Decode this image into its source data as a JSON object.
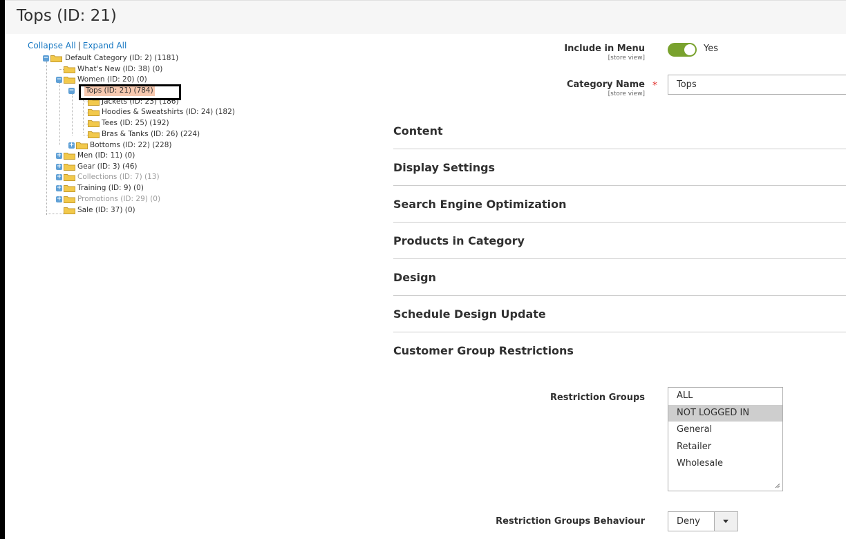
{
  "page": {
    "title": "Tops (ID: 21)"
  },
  "tree": {
    "collapse_all": "Collapse All",
    "separator": "|",
    "expand_all": "Expand All",
    "nodes": [
      {
        "label": "Default Category (ID: 2) (1181)",
        "toggle": "−"
      },
      {
        "label": "What's New (ID: 38) (0)"
      },
      {
        "label": "Women (ID: 20) (0)",
        "toggle": "−"
      },
      {
        "label": "Tops (ID: 21) (784)",
        "toggle": "−",
        "selected": true
      },
      {
        "label": "Jackets (ID: 23) (186)"
      },
      {
        "label": "Hoodies & Sweatshirts (ID: 24) (182)"
      },
      {
        "label": "Tees (ID: 25) (192)"
      },
      {
        "label": "Bras & Tanks (ID: 26) (224)"
      },
      {
        "label": "Bottoms (ID: 22) (228)",
        "toggle": "+"
      },
      {
        "label": "Men (ID: 11) (0)",
        "toggle": "+"
      },
      {
        "label": "Gear (ID: 3) (46)",
        "toggle": "+"
      },
      {
        "label": "Collections (ID: 7) (13)",
        "toggle": "+",
        "disabled": true
      },
      {
        "label": "Training (ID: 9) (0)",
        "toggle": "+"
      },
      {
        "label": "Promotions (ID: 29) (0)",
        "toggle": "+",
        "disabled": true
      },
      {
        "label": "Sale (ID: 37) (0)"
      }
    ]
  },
  "form": {
    "include_menu": {
      "label": "Include in Menu",
      "scope": "[store view]",
      "value": "Yes",
      "checked": true
    },
    "category_name": {
      "label": "Category Name",
      "scope": "[store view]",
      "required_mark": "*",
      "value": "Tops"
    }
  },
  "sections": [
    {
      "title": "Content"
    },
    {
      "title": "Display Settings"
    },
    {
      "title": "Search Engine Optimization"
    },
    {
      "title": "Products in Category"
    },
    {
      "title": "Design"
    },
    {
      "title": "Schedule Design Update"
    },
    {
      "title": "Customer Group Restrictions"
    }
  ],
  "restrictions": {
    "groups_label": "Restriction Groups",
    "options": [
      {
        "label": "ALL"
      },
      {
        "label": "NOT LOGGED IN",
        "selected": true
      },
      {
        "label": "General"
      },
      {
        "label": "Retailer"
      },
      {
        "label": "Wholesale"
      }
    ],
    "behaviour_label": "Restriction Groups Behaviour",
    "behaviour_value": "Deny"
  },
  "colors": {
    "link": "#1979c3",
    "toggle_on": "#79a22e",
    "selected_node": "#f7c9b0",
    "required": "#e02b27",
    "tree_toggle": "#5fa0d6",
    "folder": "#f2c94c"
  },
  "icons": {
    "folder": "folder-icon",
    "tree_toggle": "tree-toggle-icon",
    "dropdown": "chevron-down-icon",
    "resize": "resize-grip-icon"
  }
}
